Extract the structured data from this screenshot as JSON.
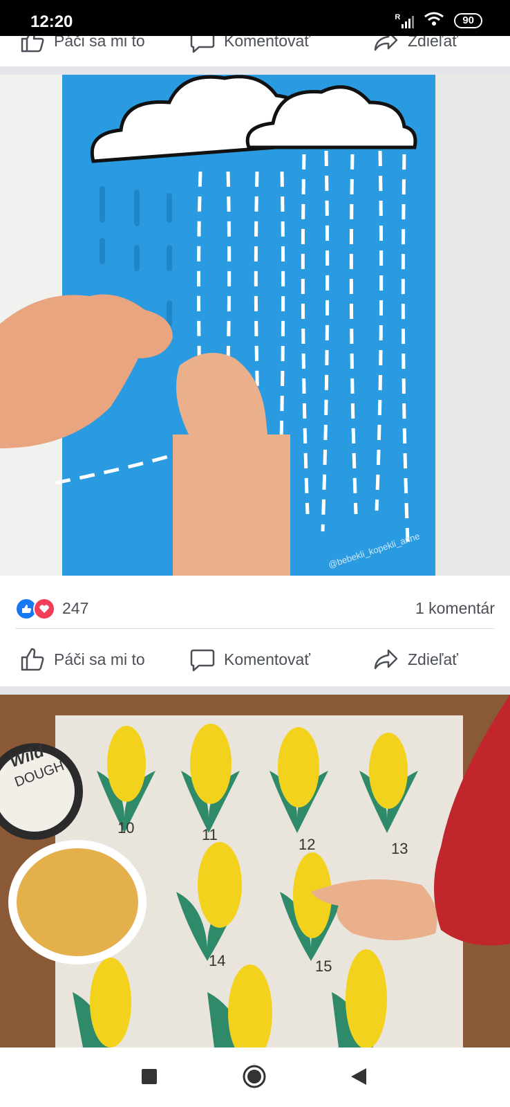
{
  "status_bar": {
    "time": "12:20",
    "battery": "90",
    "signal_indicator": "R"
  },
  "top_actions": {
    "like": "Páči sa mi to",
    "comment": "Komentovať",
    "share": "Zdieľať"
  },
  "post1": {
    "watermark": "@bebekli_kopekli_anne",
    "reaction_count": "247",
    "comment_count": "1 komentár",
    "actions": {
      "like": "Páči sa mi to",
      "comment": "Komentovať",
      "share": "Zdieľať"
    }
  },
  "post2": {
    "jar_label_1": "Wild",
    "jar_label_2": "DOUGH",
    "numbers": [
      "10",
      "11",
      "12",
      "13",
      "14",
      "15"
    ]
  },
  "colors": {
    "like_blue": "#1877f2",
    "love_red": "#f33e58",
    "divider": "#e4e6eb",
    "board_blue": "#2a9be0"
  },
  "icons": [
    "thumbs-up-icon",
    "comment-icon",
    "share-icon",
    "like-reaction-icon",
    "love-reaction-icon",
    "stop-square-icon",
    "home-circle-icon",
    "back-triangle-icon"
  ]
}
